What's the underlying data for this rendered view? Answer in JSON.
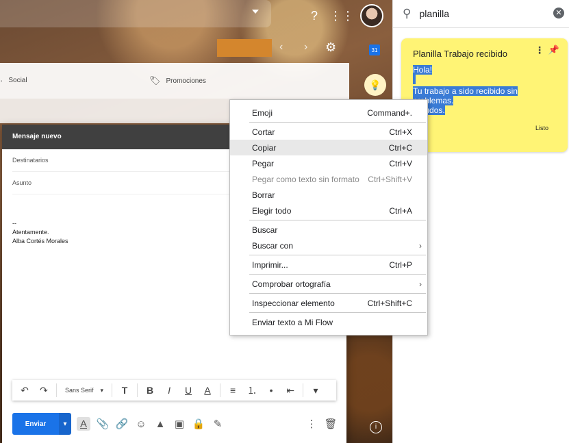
{
  "gmail": {
    "tabs": [
      {
        "label": "Social",
        "icon": "people-icon"
      },
      {
        "label": "Promociones",
        "icon": "tag-icon"
      }
    ],
    "compose": {
      "title": "Mensaje nuevo",
      "to_placeholder": "Destinatarios",
      "subject_placeholder": "Asunto",
      "signature": [
        "--",
        "Atentamente.",
        "Alba Cortés Morales"
      ],
      "font": "Sans Serif",
      "send_label": "Enviar"
    }
  },
  "search": {
    "query": "planilla"
  },
  "note": {
    "title": "Planilla Trabajo recibido",
    "lines": [
      "Hola!",
      "",
      "Tu trabajo a sido recibido sin",
      "problemas.",
      "Saludos."
    ],
    "done_label": "Listo",
    "accent": "#fff475"
  },
  "context_menu": {
    "items": [
      {
        "label": "Emoji",
        "shortcut": "Command+."
      },
      {
        "label": "Cortar",
        "shortcut": "Ctrl+X"
      },
      {
        "label": "Copiar",
        "shortcut": "Ctrl+C"
      },
      {
        "label": "Pegar",
        "shortcut": "Ctrl+V"
      },
      {
        "label": "Pegar como texto sin formato",
        "shortcut": "Ctrl+Shift+V"
      },
      {
        "label": "Borrar",
        "shortcut": ""
      },
      {
        "label": "Elegir todo",
        "shortcut": "Ctrl+A"
      },
      {
        "label": "Buscar",
        "shortcut": ""
      },
      {
        "label": "Buscar con",
        "shortcut": ""
      },
      {
        "label": "Imprimir...",
        "shortcut": "Ctrl+P"
      },
      {
        "label": "Comprobar ortografía",
        "shortcut": ""
      },
      {
        "label": "Inspeccionar elemento",
        "shortcut": "Ctrl+Shift+C"
      },
      {
        "label": "Enviar texto a Mi Flow",
        "shortcut": ""
      }
    ]
  },
  "colors": {
    "primary": "#1a73e8",
    "compose_header": "#404040"
  },
  "calendar_day": "31"
}
